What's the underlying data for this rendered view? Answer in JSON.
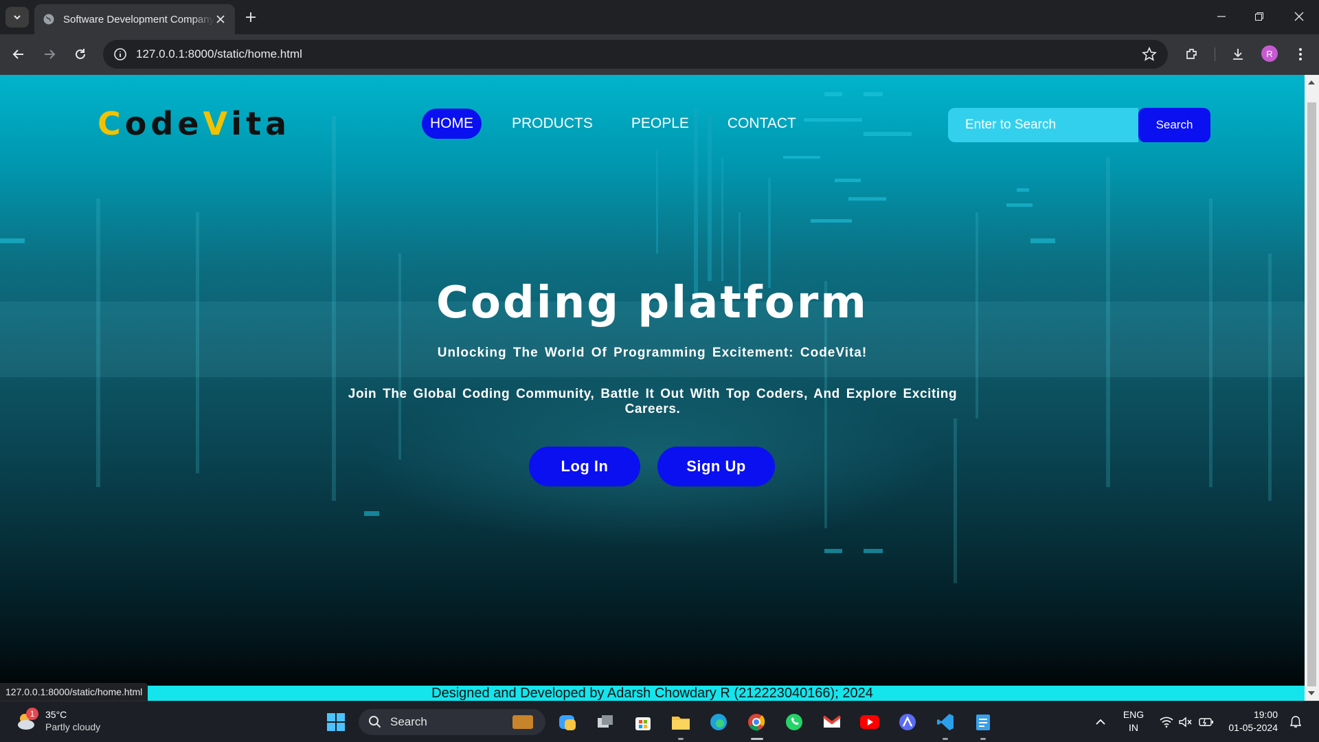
{
  "browser": {
    "tab_title": "Software Development Company",
    "url": "127.0.0.1:8000/static/home.html",
    "profile_initial": "R"
  },
  "page": {
    "logo": {
      "part1": "C",
      "part2": "ode",
      "part3": "V",
      "part4": "ita"
    },
    "nav": [
      "HOME",
      "PRODUCTS",
      "PEOPLE",
      "CONTACT"
    ],
    "search": {
      "placeholder": "Enter to Search",
      "button": "Search"
    },
    "hero": {
      "title": "Coding platform",
      "subtitle": "Unlocking The World Of Programming Excitement: CodeVita!",
      "description": "Join The Global Coding Community, Battle It Out With Top Coders, And Explore Exciting Careers.",
      "login": "Log In",
      "signup": "Sign Up"
    },
    "footer": "Designed and Developed by Adarsh Chowdary R (212223040166); 2024",
    "status_url": "127.0.0.1:8000/static/home.html"
  },
  "colors": {
    "accent_blue": "#0a10f0",
    "logo_yellow": "#f2c200",
    "footer_cyan": "#14e4ec"
  },
  "taskbar": {
    "weather_temp": "35°C",
    "weather_cond": "Partly cloudy",
    "weather_badge": "1",
    "search_label": "Search",
    "lang1": "ENG",
    "lang2": "IN",
    "time": "19:00",
    "date": "01-05-2024"
  }
}
